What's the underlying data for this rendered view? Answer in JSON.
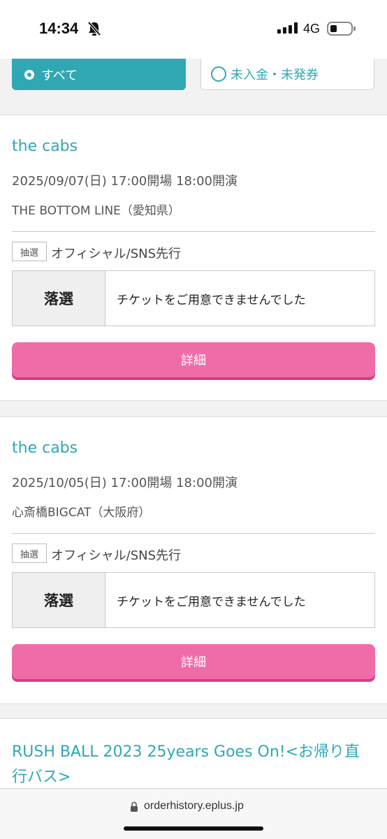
{
  "status": {
    "time": "14:34",
    "network": "4G"
  },
  "filters": {
    "all_label": "すべて",
    "unpaid_label": "未入金・未発券"
  },
  "events": [
    {
      "title": "the cabs",
      "date": "2025/09/07(日) 17:00開場 18:00開演",
      "venue": "THE BOTTOM LINE（愛知県）",
      "tag": "抽選",
      "sale_type": "オフィシャル/SNS先行",
      "result": "落選",
      "message": "チケットをご用意できませんでした",
      "detail_label": "詳細"
    },
    {
      "title": "the cabs",
      "date": "2025/10/05(日) 17:00開場 18:00開演",
      "venue": "心斎橋BIGCAT（大阪府）",
      "tag": "抽選",
      "sale_type": "オフィシャル/SNS先行",
      "result": "落選",
      "message": "チケットをご用意できませんでした",
      "detail_label": "詳細"
    },
    {
      "title": "RUSH BALL 2023 25years Goes On!<お帰り直行バス>"
    }
  ],
  "browser": {
    "url": "orderhistory.eplus.jp"
  },
  "colors": {
    "teal": "#2fa8b4",
    "pink": "#f06ca8"
  }
}
